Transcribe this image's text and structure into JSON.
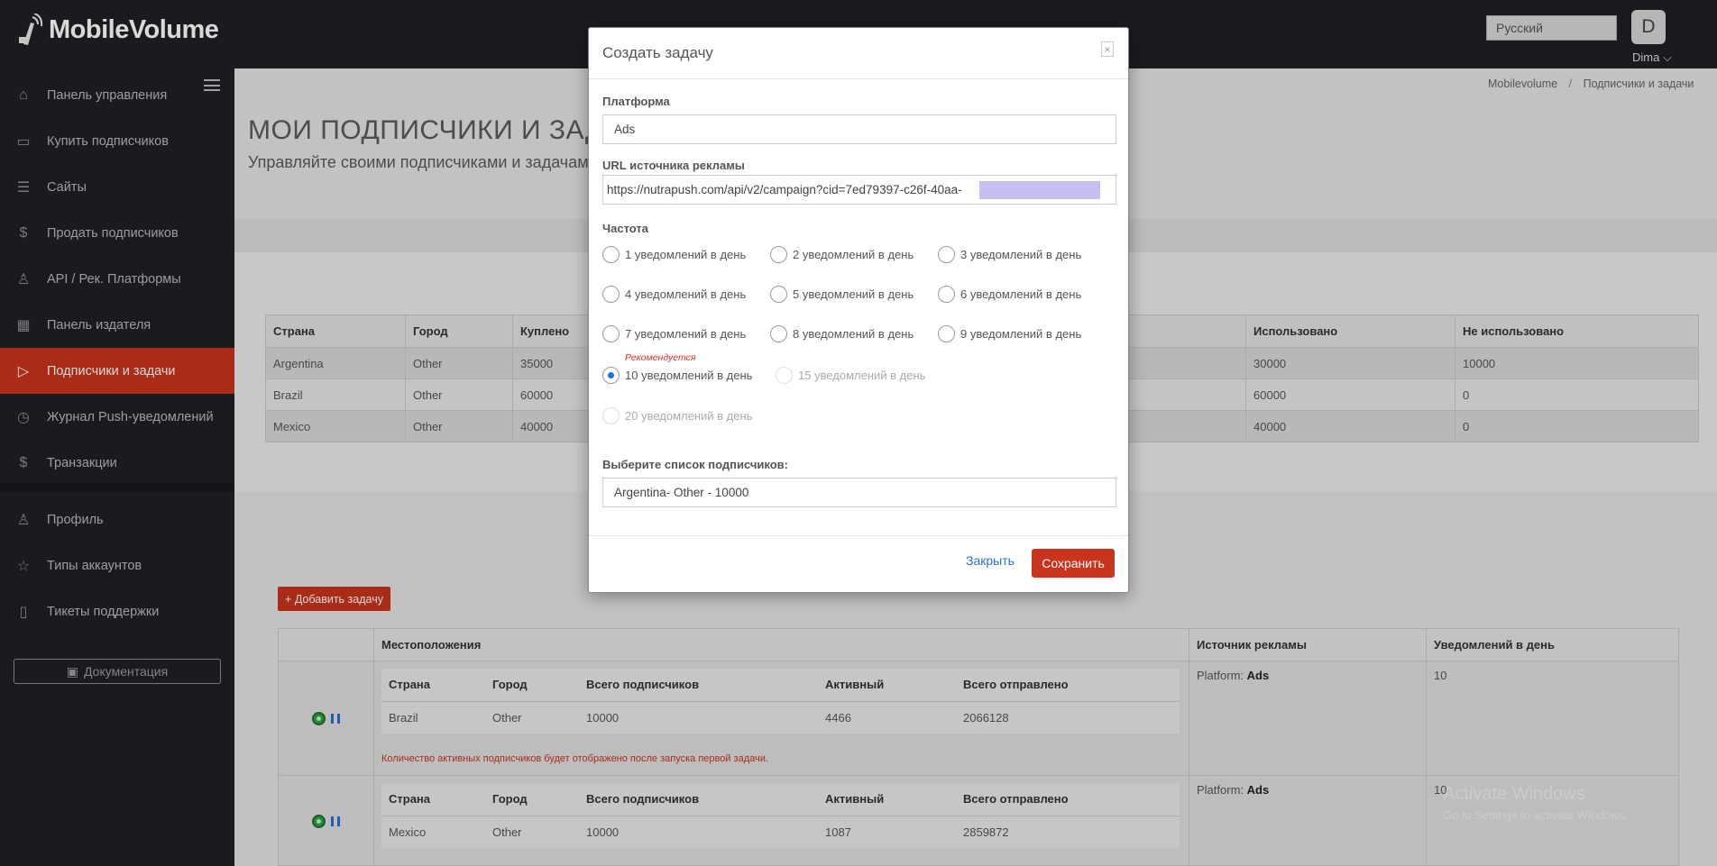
{
  "app": {
    "brand": "MobileVolume"
  },
  "sidebar": {
    "items": [
      {
        "label": "Панель управления",
        "icon": "home-icon",
        "glyph": "⌂"
      },
      {
        "label": "Купить подписчиков",
        "icon": "card-icon",
        "glyph": "▭"
      },
      {
        "label": "Сайты",
        "icon": "list-icon",
        "glyph": "☰"
      },
      {
        "label": "Продать подписчиков",
        "icon": "dollar-icon",
        "glyph": "$"
      },
      {
        "label": "API / Рек. Платформы",
        "icon": "rocket-icon",
        "glyph": "♙"
      },
      {
        "label": "Панель издателя",
        "icon": "chart-icon",
        "glyph": "▦"
      },
      {
        "label": "Подписчики и задачи",
        "icon": "play-icon",
        "glyph": "▷"
      },
      {
        "label": "Журнал Push-уведомлений",
        "icon": "clock-icon",
        "glyph": "◷"
      },
      {
        "label": "Транзакции",
        "icon": "dollar-icon",
        "glyph": "$"
      },
      {
        "label": "Профиль",
        "icon": "user-icon",
        "glyph": "♙"
      },
      {
        "label": "Типы аккаунтов",
        "icon": "star-icon",
        "glyph": "☆"
      },
      {
        "label": "Тикеты поддержки",
        "icon": "ticket-icon",
        "glyph": "▯"
      }
    ],
    "docs_label": "Документация"
  },
  "topbar": {
    "language": "Русский",
    "avatar_letter": "D",
    "user_name": "Dima ⌵"
  },
  "breadcrumb": {
    "home": "Mobilevolume",
    "separator": "/",
    "current": "Подписчики и задачи"
  },
  "page": {
    "title": "МОИ ПОДПИСЧИКИ И ЗАДА",
    "subtitle": "Управляйте своими подписчиками и задачам"
  },
  "subscribers_table": {
    "headers": [
      "Страна",
      "Город",
      "Куплено",
      "Использовано",
      "Не использовано"
    ],
    "rows": [
      [
        "Argentina",
        "Other",
        "35000",
        "30000",
        "10000"
      ],
      [
        "Brazil",
        "Other",
        "60000",
        "60000",
        "0"
      ],
      [
        "Mexico",
        "Other",
        "40000",
        "40000",
        "0"
      ]
    ]
  },
  "tasks": {
    "add_button": "+ Добавить задачу",
    "headers": [
      "Местоположения",
      "Источник рекламы",
      "Уведомлений в день"
    ],
    "inner_headers": [
      "Страна",
      "Город",
      "Всего подписчиков",
      "Активный",
      "Всего отправлено"
    ],
    "rows": [
      {
        "cells": [
          "Brazil",
          "Other",
          "10000",
          "4466",
          "2066128"
        ],
        "platform_label": "Platform:",
        "platform": "Ads",
        "per_day": "10",
        "note": "Количество активных подписчиков будет отображено после запуска первой задачи."
      },
      {
        "cells": [
          "Mexico",
          "Other",
          "10000",
          "1087",
          "2859872"
        ],
        "platform_label": "Platform:",
        "platform": "Ads",
        "per_day": "10"
      }
    ]
  },
  "watermark": {
    "line1": "Activate Windows",
    "line2": "Go to Settings to activate Windows."
  },
  "modal": {
    "title": "Создать задачу",
    "close_glyph": "×",
    "platform_label": "Платформа",
    "platform_value": "Ads",
    "url_label": "URL источника рекламы",
    "url_value": "https://nutrapush.com/api/v2/campaign?cid=7ed79397-c26f-40aa-",
    "frequency_label": "Частота",
    "frequency_options": [
      "1 уведомлений в день",
      "2 уведомлений в день",
      "3 уведомлений в день",
      "4 уведомлений в день",
      "5 уведомлений в день",
      "6 уведомлений в день",
      "7 уведомлений в день",
      "8 уведомлений в день",
      "9 уведомлений в день",
      "10 уведомлений в день",
      "15 уведомлений в день",
      "20 уведомлений в день"
    ],
    "recommended": "Рекомендуется",
    "selected_frequency": "10 уведомлений в день",
    "list_label": "Выберите список подписчиков:",
    "list_value": "Argentina- Other - 10000",
    "close_button": "Закрыть",
    "save_button": "Сохранить"
  }
}
